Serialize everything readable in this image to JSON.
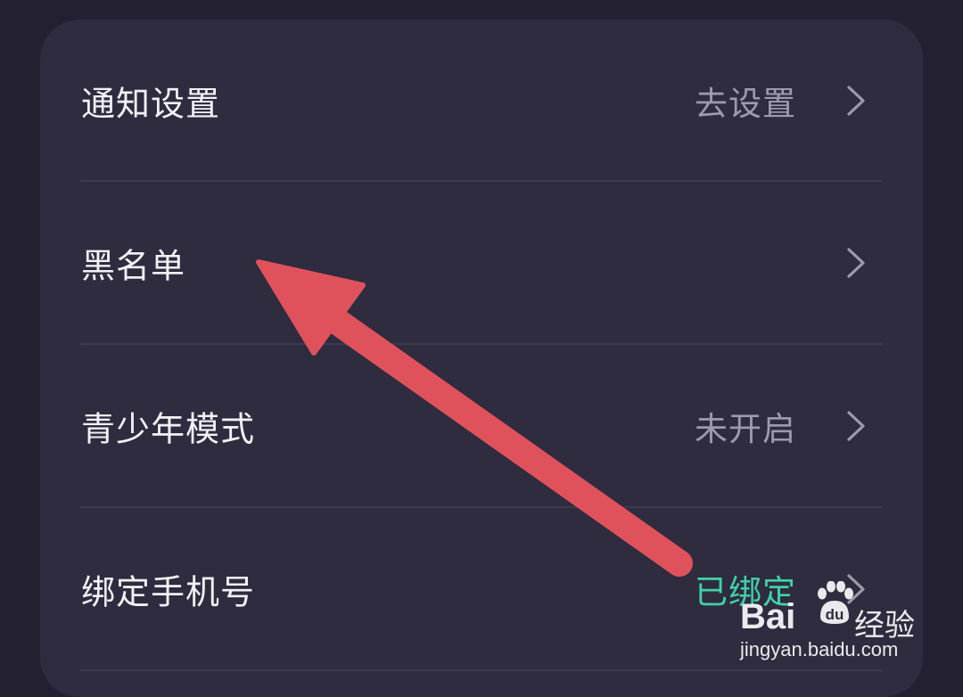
{
  "settings": {
    "rows": [
      {
        "label": "通知设置",
        "value": "去设置"
      },
      {
        "label": "黑名单",
        "value": ""
      },
      {
        "label": "青少年模式",
        "value": "未开启"
      },
      {
        "label": "绑定手机号",
        "value": "已绑定"
      }
    ],
    "chevron_icon": "chevron-right-icon"
  },
  "annotation": {
    "arrow_color": "#e0525b",
    "icon": "red-arrow-icon"
  },
  "watermark": {
    "brand_text": "Bai",
    "brand_icon": "paw-icon",
    "product": "经验",
    "url": "jingyan.baidu.com"
  },
  "colors": {
    "background": "#232032",
    "card": "#2f2c40",
    "label": "#f2f1f6",
    "value": "#9d9aab",
    "value_active": "#3fd2a8"
  }
}
